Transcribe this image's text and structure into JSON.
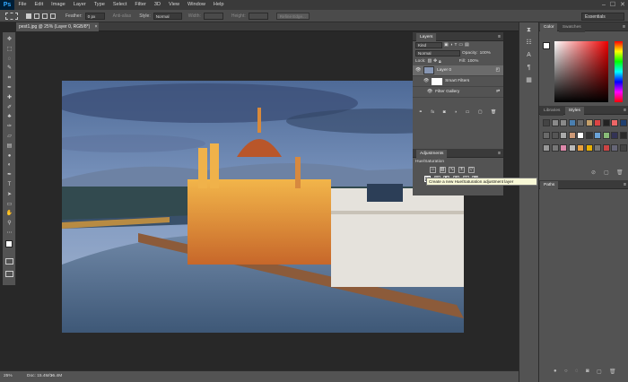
{
  "app": {
    "logo": "Ps",
    "workspace": "Essentials"
  },
  "menu": [
    "File",
    "Edit",
    "Image",
    "Layer",
    "Type",
    "Select",
    "Filter",
    "3D",
    "View",
    "Window",
    "Help"
  ],
  "window_controls": {
    "minimize": "–",
    "restore": "☐",
    "close": "✕"
  },
  "options_bar": {
    "feather_label": "Feather:",
    "feather_value": "0 px",
    "antialias_label": "Anti-alias",
    "style_label": "Style:",
    "style_value": "Normal",
    "width_label": "Width:",
    "height_label": "Height:",
    "refine_edge": "Refine Edge..."
  },
  "document_tab": {
    "title": "pest1.jpg @ 25% (Layer 0, RGB/8*)",
    "close": "×"
  },
  "status_bar": {
    "zoom": "25%",
    "doc_info": "Doc: 15.4M/15.4M"
  },
  "tools": [
    {
      "icon": "move-tool-icon",
      "glyph": "✥"
    },
    {
      "icon": "marquee-tool-icon",
      "glyph": "⬚"
    },
    {
      "icon": "lasso-tool-icon",
      "glyph": "◌"
    },
    {
      "icon": "quick-select-tool-icon",
      "glyph": "✎"
    },
    {
      "icon": "crop-tool-icon",
      "glyph": "⌗"
    },
    {
      "icon": "eyedropper-tool-icon",
      "glyph": "✒"
    },
    {
      "icon": "healing-brush-tool-icon",
      "glyph": "✚"
    },
    {
      "icon": "brush-tool-icon",
      "glyph": "✐"
    },
    {
      "icon": "clone-stamp-tool-icon",
      "glyph": "♣"
    },
    {
      "icon": "history-brush-tool-icon",
      "glyph": "✑"
    },
    {
      "icon": "eraser-tool-icon",
      "glyph": "▱"
    },
    {
      "icon": "gradient-tool-icon",
      "glyph": "▤"
    },
    {
      "icon": "blur-tool-icon",
      "glyph": "●"
    },
    {
      "icon": "dodge-tool-icon",
      "glyph": "◐"
    },
    {
      "icon": "pen-tool-icon",
      "glyph": "✒"
    },
    {
      "icon": "type-tool-icon",
      "glyph": "T"
    },
    {
      "icon": "path-select-tool-icon",
      "glyph": "➤"
    },
    {
      "icon": "shape-tool-icon",
      "glyph": "▭"
    },
    {
      "icon": "hand-tool-icon",
      "glyph": "✋"
    },
    {
      "icon": "zoom-tool-icon",
      "glyph": "⚲"
    },
    {
      "icon": "more-tools-icon",
      "glyph": "⋯"
    }
  ],
  "layers_panel": {
    "tab": "Layers",
    "kind_label": "Kind",
    "blend_mode": "Normal",
    "opacity_label": "Opacity:",
    "opacity_value": "100%",
    "lock_label": "Lock:",
    "fill_label": "Fill:",
    "fill_value": "100%",
    "layers": [
      {
        "name": "Layer 0"
      },
      {
        "name": "Smart Filters"
      },
      {
        "name": "Filter Gallery"
      }
    ]
  },
  "adjustments_panel": {
    "tab": "Adjustments",
    "hover_label": "Hue/Saturation",
    "tooltip": "Create a new Hue/Saturation adjustment layer"
  },
  "color_panel": {
    "tabs": [
      "Color",
      "Swatches"
    ],
    "foreground": "#ffffff",
    "background": "#000000"
  },
  "libraries_panel": {
    "tabs": [
      "Libraries",
      "Styles"
    ]
  },
  "paths_panel": {
    "tab": "Paths"
  },
  "colors": {
    "ui_dark": "#282828",
    "ui_panel": "#535353",
    "accent": "#31a8ff"
  }
}
